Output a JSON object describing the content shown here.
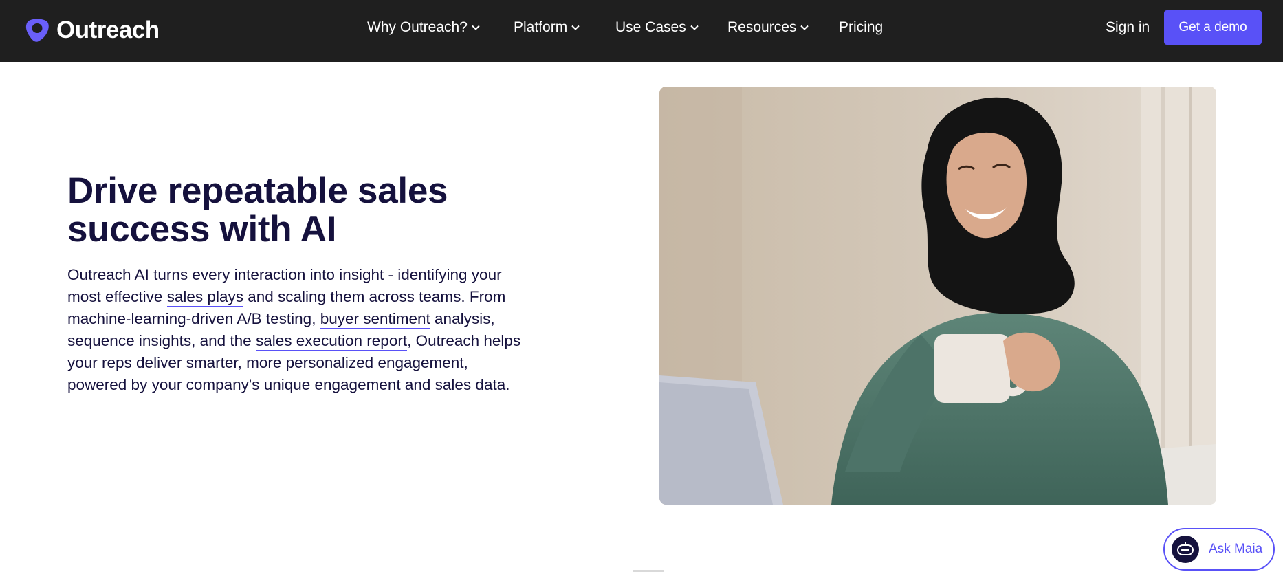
{
  "brand": {
    "name": "Outreach",
    "accent": "#5951f7",
    "nav_bg": "#1f1f1f",
    "text_dark": "#15113d"
  },
  "nav": {
    "items": [
      {
        "label": "Why Outreach?",
        "has_dropdown": true
      },
      {
        "label": "Platform",
        "has_dropdown": true
      },
      {
        "label": "Use Cases",
        "has_dropdown": true
      },
      {
        "label": "Resources",
        "has_dropdown": true
      },
      {
        "label": "Pricing",
        "has_dropdown": false
      }
    ],
    "sign_in": "Sign in",
    "cta": "Get a demo"
  },
  "hero": {
    "title_line1": "Drive repeatable sales",
    "title_line2": "success with AI",
    "body_1": "Outreach AI turns every interaction into insight - identifying your most effective ",
    "link_1": "sales plays",
    "body_2": " and scaling them across teams. From machine-learning-driven A/B testing, ",
    "link_2": "buyer sentiment",
    "body_3": " analysis, sequence insights, and the ",
    "link_3": "sales execution report",
    "body_4": ", Outreach helps your reps deliver smarter, more personalized engagement, powered by your company's unique engagement and sales data."
  },
  "chat": {
    "label": "Ask Maia",
    "icon": "robot-icon"
  }
}
